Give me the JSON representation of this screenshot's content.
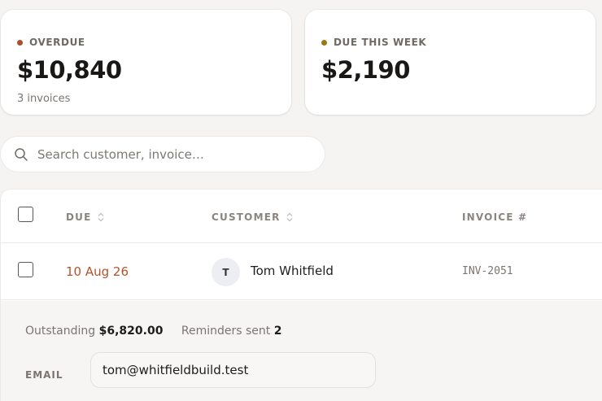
{
  "summary": {
    "overdue": {
      "label": "OVERDUE",
      "amount": "$10,840",
      "sub": "3 invoices",
      "dot_color": "#a9502c"
    },
    "due_week": {
      "label": "DUE THIS WEEK",
      "amount": "$2,190",
      "dot_color": "#9a7a12"
    }
  },
  "search": {
    "placeholder": "Search customer, invoice…",
    "value": "",
    "icon": "search-icon"
  },
  "table": {
    "columns": [
      {
        "label": "DUE",
        "sortable": true
      },
      {
        "label": "CUSTOMER",
        "sortable": true
      },
      {
        "label": "INVOICE #",
        "sortable": false
      }
    ],
    "rows": [
      {
        "due": "10 Aug 26",
        "avatar_initial": "T",
        "customer": "Tom Whitfield",
        "invoice": "INV-2051",
        "checked": false,
        "expanded": {
          "outstanding_label": "Outstanding",
          "outstanding_value": "$6,820.00",
          "reminders_label": "Reminders sent",
          "reminders_value": "2",
          "email_label": "EMAIL",
          "email_value": "tom@whitfieldbuild.test"
        }
      }
    ]
  },
  "colors": {
    "accent_overdue": "#b5522a",
    "background": "#f5f4f2"
  }
}
